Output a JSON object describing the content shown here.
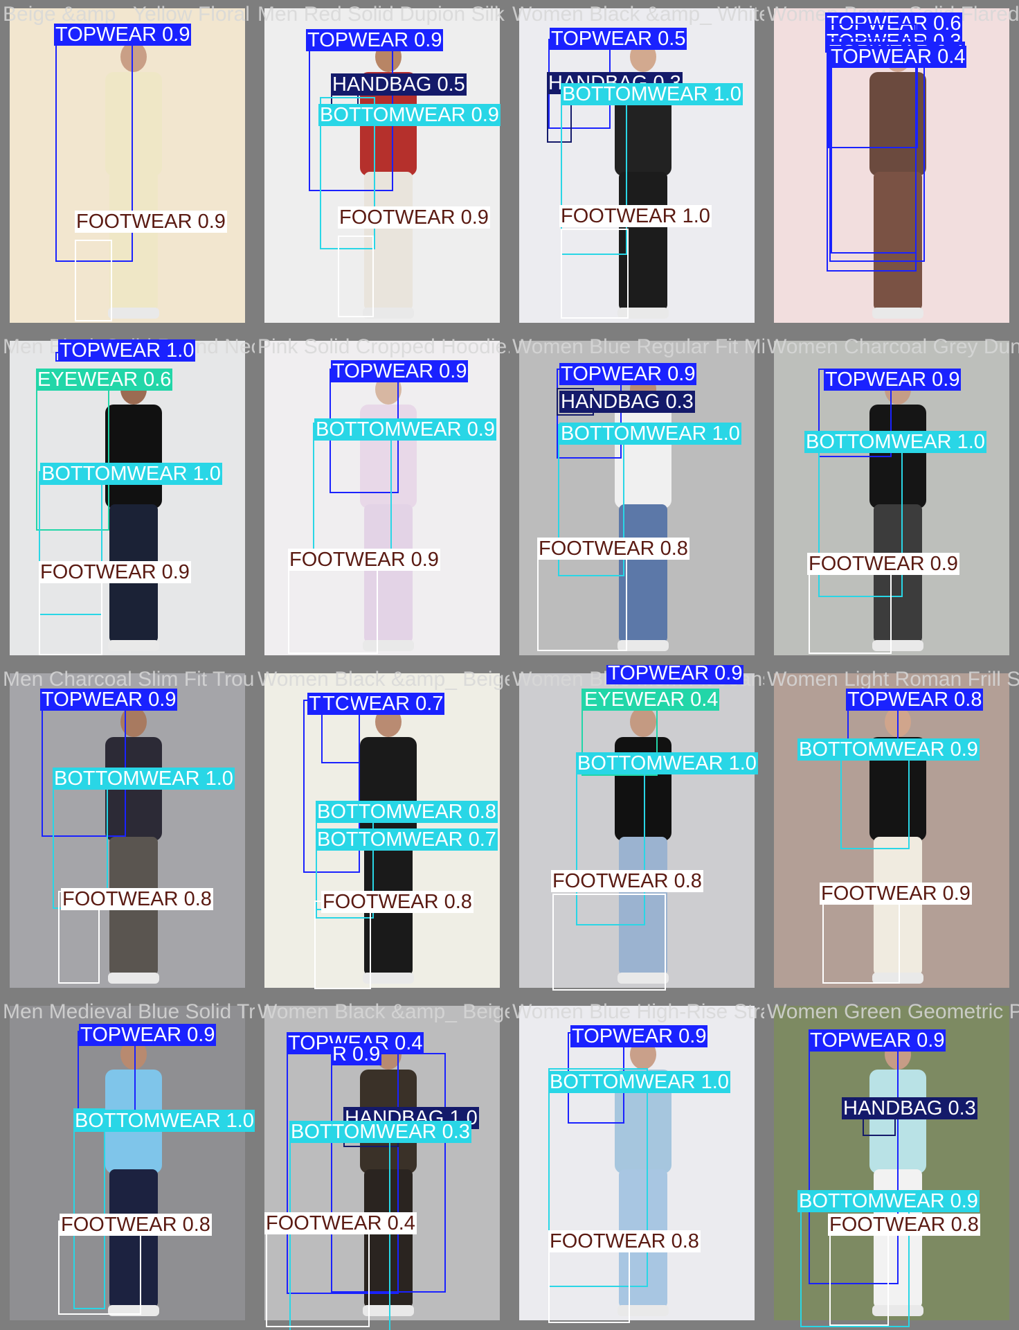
{
  "colors": {
    "TOPWEAR": {
      "box": "#1a22ff",
      "bg": "#1a22ff",
      "fg": "#ffffff"
    },
    "BOTTOMWEAR": {
      "box": "#29d6e6",
      "bg": "#29d6e6",
      "fg": "#ffffff"
    },
    "FOOTWEAR": {
      "box": "#ffffff",
      "bg": "#ffffff",
      "fg": "#5a1a12"
    },
    "HANDBAG": {
      "box": "#141a6a",
      "bg": "#141a6a",
      "fg": "#ffffff"
    },
    "EYEWEAR": {
      "box": "#22d6a8",
      "bg": "#22d6a8",
      "fg": "#ffffff"
    }
  },
  "tiles": [
    {
      "caption": "Beige &amp_ Yellow Floral Printed Kurta",
      "bg": "#f2e6cf",
      "figure": {
        "top": "#efe7c6",
        "bottom": "#efe7c6",
        "skin": "#c99f86"
      }
    },
    {
      "caption": "Men Red Solid Dupion Silk Straight Kurta",
      "bg": "#eeeeee",
      "figure": {
        "top": "#b5302c",
        "bottom": "#e9e4dc",
        "skin": "#b88565"
      }
    },
    {
      "caption": "Women Black &amp_ White Slim Fit Track Pants",
      "bg": "#ececf0",
      "figure": {
        "top": "#222222",
        "bottom": "#1c1c1c",
        "skin": "#d2a98f"
      }
    },
    {
      "caption": "Women Brown Solid Flared Trousers",
      "bg": "#f2dede",
      "figure": {
        "top": "#6b4a3e",
        "bottom": "#7a5244",
        "skin": "#d3aa96"
      }
    },
    {
      "caption": "Men Black Solid Round Neck T-shirt",
      "bg": "#e6e7e8",
      "figure": {
        "top": "#111111",
        "bottom": "#1b2236",
        "skin": "#9b6b52"
      }
    },
    {
      "caption": "Pink Solid Cropped Hoodie.jpg",
      "bg": "#f0eef0",
      "figure": {
        "top": "#e8d8e8",
        "bottom": "#e3d3e6",
        "skin": "#d7b7a2"
      }
    },
    {
      "caption": "Women Blue Regular Fit Mid-Rise Clean Look",
      "bg": "#bcbcbc",
      "figure": {
        "top": "#f0f0f0",
        "bottom": "#5c78a8",
        "skin": "#b98b72"
      }
    },
    {
      "caption": "Women Charcoal Grey Dungarees",
      "bg": "#bdbfbb",
      "figure": {
        "top": "#151515",
        "bottom": "#3c3c3c",
        "skin": "#c59d86"
      }
    },
    {
      "caption": "Men Charcoal Slim Fit Trousers.jpg",
      "bg": "#a5a5a9",
      "figure": {
        "top": "#2c2a36",
        "bottom": "#5a5550",
        "skin": "#a87a60"
      }
    },
    {
      "caption": "Women Black &amp_ Beige Chevron Printed Kurta",
      "bg": "#efeee5",
      "figure": {
        "top": "#1a1a1a",
        "bottom": "#1a1a1a",
        "skin": "#b98b72"
      }
    },
    {
      "caption": "Women Blue Mom Fit Jeans",
      "bg": "#cdcdd0",
      "figure": {
        "top": "#111111",
        "bottom": "#9bb3d0",
        "skin": "#c49a82"
      }
    },
    {
      "caption": "Women Light Roman Frill Skirt",
      "bg": "#b39f96",
      "figure": {
        "top": "#141414",
        "bottom": "#f0ebe0",
        "skin": "#d0a58c"
      }
    },
    {
      "caption": "Men Medieval Blue Solid Track Pants",
      "bg": "#8f8f92",
      "figure": {
        "top": "#7fc5ea",
        "bottom": "#1c2240",
        "skin": "#b88a70"
      }
    },
    {
      "caption": "Women Black &amp_ Beige Printed Kurta",
      "bg": "#bcbcbd",
      "figure": {
        "top": "#3a3128",
        "bottom": "#2a2420",
        "skin": "#b88a70"
      }
    },
    {
      "caption": "Women Blue High-Rise Straight Fit Jeans",
      "bg": "#ebebef",
      "figure": {
        "top": "#a6c6de",
        "bottom": "#a8c6e2",
        "skin": "#c9a08a"
      }
    },
    {
      "caption": "Women Green Geometric Printed Kurta",
      "bg": "#7d8a62",
      "figure": {
        "top": "#b9e2e6",
        "bottom": "#f2f2f2",
        "skin": "#c69c86"
      }
    }
  ],
  "detections": [
    [
      {
        "cls": "TOPWEAR",
        "text": "TOPWEAR 0.9"
      },
      {
        "cls": "FOOTWEAR",
        "text": "FOOTWEAR 0.9"
      }
    ],
    [
      {
        "cls": "TOPWEAR",
        "text": "TOPWEAR 0.9"
      },
      {
        "cls": "HANDBAG",
        "text": "HANDBAG 0.5"
      },
      {
        "cls": "BOTTOMWEAR",
        "text": "BOTTOMWEAR 0.9"
      },
      {
        "cls": "FOOTWEAR",
        "text": "FOOTWEAR 0.9"
      }
    ],
    [
      {
        "cls": "TOPWEAR",
        "text": "TOPWEAR 0.5"
      },
      {
        "cls": "HANDBAG",
        "text": "HANDBAG 0.3"
      },
      {
        "cls": "BOTTOMWEAR",
        "text": "BOTTOMWEAR 1.0"
      },
      {
        "cls": "FOOTWEAR",
        "text": "FOOTWEAR 1.0"
      }
    ],
    [
      {
        "cls": "TOPWEAR",
        "text": "TOPWEAR 0.6"
      },
      {
        "cls": "TOPWEAR",
        "text": "TOPWEAR 0.3"
      },
      {
        "cls": "TOPWEAR",
        "text": "TOPWEAR 0.4"
      },
      {
        "cls": "TOPWEAR",
        "text": "TOPWEAR 0.4"
      }
    ],
    [
      {
        "cls": "EYEWEAR",
        "text": "EYEWEAR 0.6"
      },
      {
        "cls": "TOPWEAR",
        "text": "TOPWEAR 1.0"
      },
      {
        "cls": "BOTTOMWEAR",
        "text": "BOTTOMWEAR 1.0"
      },
      {
        "cls": "FOOTWEAR",
        "text": "FOOTWEAR 0.9"
      }
    ],
    [
      {
        "cls": "TOPWEAR",
        "text": "TOPWEAR 0.9"
      },
      {
        "cls": "BOTTOMWEAR",
        "text": "BOTTOMWEAR 0.9"
      },
      {
        "cls": "FOOTWEAR",
        "text": "FOOTWEAR 0.9"
      }
    ],
    [
      {
        "cls": "TOPWEAR",
        "text": "TOPWEAR 0.9"
      },
      {
        "cls": "HANDBAG",
        "text": "HANDBAG 0.3"
      },
      {
        "cls": "BOTTOMWEAR",
        "text": "BOTTOMWEAR 1.0"
      },
      {
        "cls": "FOOTWEAR",
        "text": "FOOTWEAR 0.8"
      }
    ],
    [
      {
        "cls": "TOPWEAR",
        "text": "TOPWEAR 0.9"
      },
      {
        "cls": "BOTTOMWEAR",
        "text": "BOTTOMWEAR 1.0"
      },
      {
        "cls": "FOOTWEAR",
        "text": "FOOTWEAR 0.9"
      }
    ],
    [
      {
        "cls": "TOPWEAR",
        "text": "TOPWEAR 0.9"
      },
      {
        "cls": "BOTTOMWEAR",
        "text": "BOTTOMWEAR 1.0"
      },
      {
        "cls": "FOOTWEAR",
        "text": "FOOTWEAR 0.8"
      }
    ],
    [
      {
        "cls": "TOPWEAR",
        "text": "TOPWEAR 0.7"
      },
      {
        "cls": "TOPWEAR",
        "text": "TC"
      },
      {
        "cls": "BOTTOMWEAR",
        "text": "BOTTOMWEAR 0.8"
      },
      {
        "cls": "BOTTOMWEAR",
        "text": "BOTTOMWEAR 0.7"
      },
      {
        "cls": "FOOTWEAR",
        "text": "FOOTWEAR 0.8"
      }
    ],
    [
      {
        "cls": "EYEWEAR",
        "text": "EYEWEAR 0.4"
      },
      {
        "cls": "TOPWEAR",
        "text": "TOPWEAR 0.9"
      },
      {
        "cls": "BOTTOMWEAR",
        "text": "BOTTOMWEAR 1.0"
      },
      {
        "cls": "FOOTWEAR",
        "text": "FOOTWEAR 0.8"
      }
    ],
    [
      {
        "cls": "TOPWEAR",
        "text": "TOPWEAR 0.8"
      },
      {
        "cls": "BOTTOMWEAR",
        "text": "BOTTOMWEAR 0.9"
      },
      {
        "cls": "FOOTWEAR",
        "text": "FOOTWEAR 0.9"
      }
    ],
    [
      {
        "cls": "TOPWEAR",
        "text": "TOPWEAR 0.9"
      },
      {
        "cls": "BOTTOMWEAR",
        "text": "BOTTOMWEAR 1.0"
      },
      {
        "cls": "FOOTWEAR",
        "text": "FOOTWEAR 0.8"
      }
    ],
    [
      {
        "cls": "TOPWEAR",
        "text": "TOPWEAR 0.4"
      },
      {
        "cls": "TOPWEAR",
        "text": "R 0.9"
      },
      {
        "cls": "HANDBAG",
        "text": "HANDBAG 1.0"
      },
      {
        "cls": "BOTTOMWEAR",
        "text": "BOTTOMWEAR 0.3"
      },
      {
        "cls": "FOOTWEAR",
        "text": "FOOTWEAR 0.4"
      }
    ],
    [
      {
        "cls": "TOPWEAR",
        "text": "TOPWEAR 0.9"
      },
      {
        "cls": "BOTTOMWEAR",
        "text": "BOTTOMWEAR 1.0"
      },
      {
        "cls": "FOOTWEAR",
        "text": "FOOTWEAR 0.8"
      }
    ],
    [
      {
        "cls": "TOPWEAR",
        "text": "TOPWEAR 0.9"
      },
      {
        "cls": "HANDBAG",
        "text": "HANDBAG 0.3"
      },
      {
        "cls": "BOTTOMWEAR",
        "text": "BOTTOMWEAR 0.9"
      },
      {
        "cls": "FOOTWEAR",
        "text": "FOOTWEAR 0.8"
      }
    ]
  ]
}
